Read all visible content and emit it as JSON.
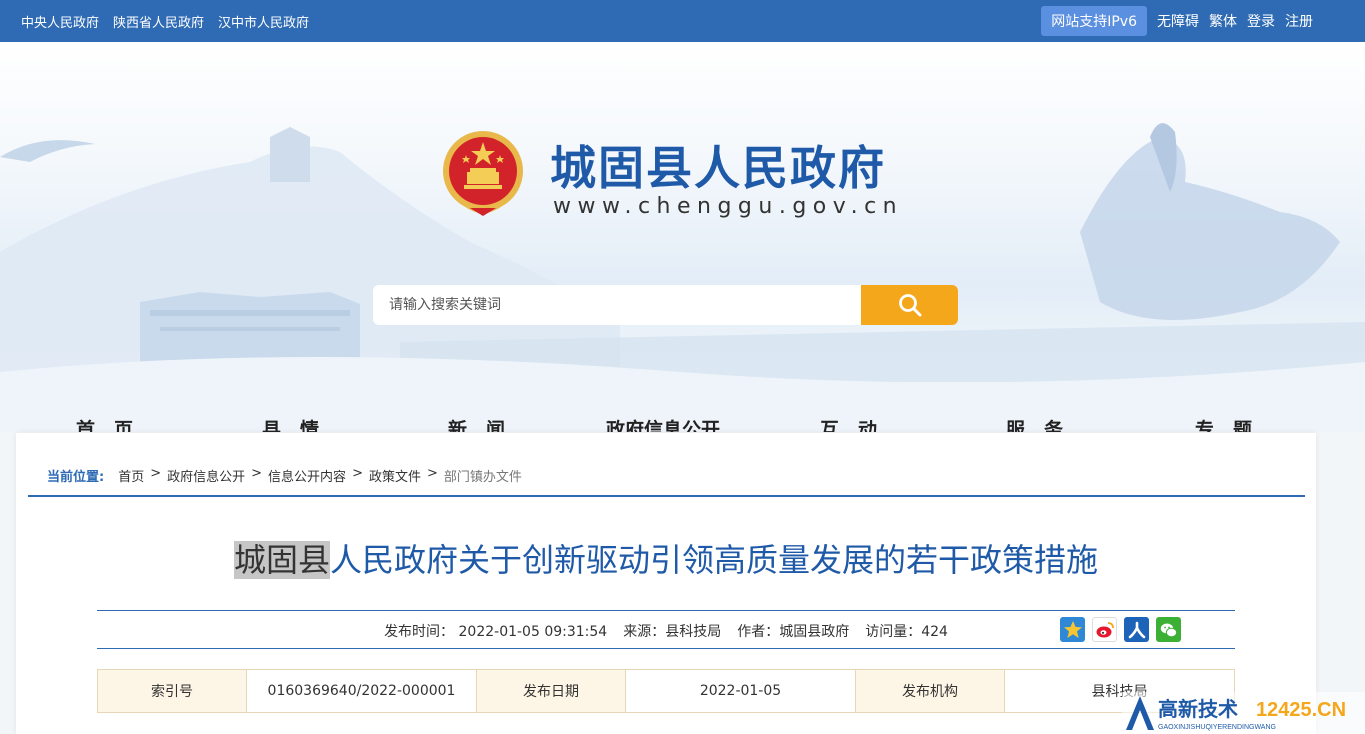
{
  "topbar": {
    "links": [
      "中央人民政府",
      "陕西省人民政府",
      "汉中市人民政府"
    ],
    "ipv6": "网站支持IPv6",
    "accessible": "无障碍",
    "traditional": "繁体",
    "login": "登录",
    "register": "注册"
  },
  "header": {
    "title": "城固县人民政府",
    "url": "www.chenggu.gov.cn"
  },
  "search": {
    "placeholder": "请输入搜索关键词"
  },
  "nav": [
    "首　页",
    "县　情",
    "新　闻",
    "政府信息公开",
    "互　动",
    "服　务",
    "专　题"
  ],
  "breadcrumb": {
    "label": "当前位置:",
    "items": [
      "首页",
      "政府信息公开",
      "信息公开内容",
      "政策文件"
    ],
    "current": "部门镇办文件",
    "separator": ">"
  },
  "article": {
    "title_highlight": "城固县",
    "title_rest": "人民政府关于创新驱动引领高质量发展的若干政策措施",
    "meta": {
      "publish_time": "发布时间：  2022-01-05 09:31:54",
      "source": "来源：县科技局",
      "author": "作者：城固县政府",
      "views": "访问量：424"
    }
  },
  "info_table": {
    "index_label": "索引号",
    "index_value": "0160369640/2022-000001",
    "date_label": "发布日期",
    "date_value": "2022-01-05",
    "org_label": "发布机构",
    "org_value": "县科技局"
  },
  "share_icons": [
    "qzone-icon",
    "weibo-icon",
    "renren-icon",
    "wechat-icon"
  ],
  "watermark": {
    "text": "高新技术",
    "site": "12425.CN",
    "pinyin": "GAOXINJISHUQIYERENDINGWANG"
  },
  "colors": {
    "brand_blue": "#2f6bb4",
    "title_blue": "#1f5aa8",
    "search_orange": "#f5a71c",
    "table_key_bg": "#fdf6e6"
  }
}
